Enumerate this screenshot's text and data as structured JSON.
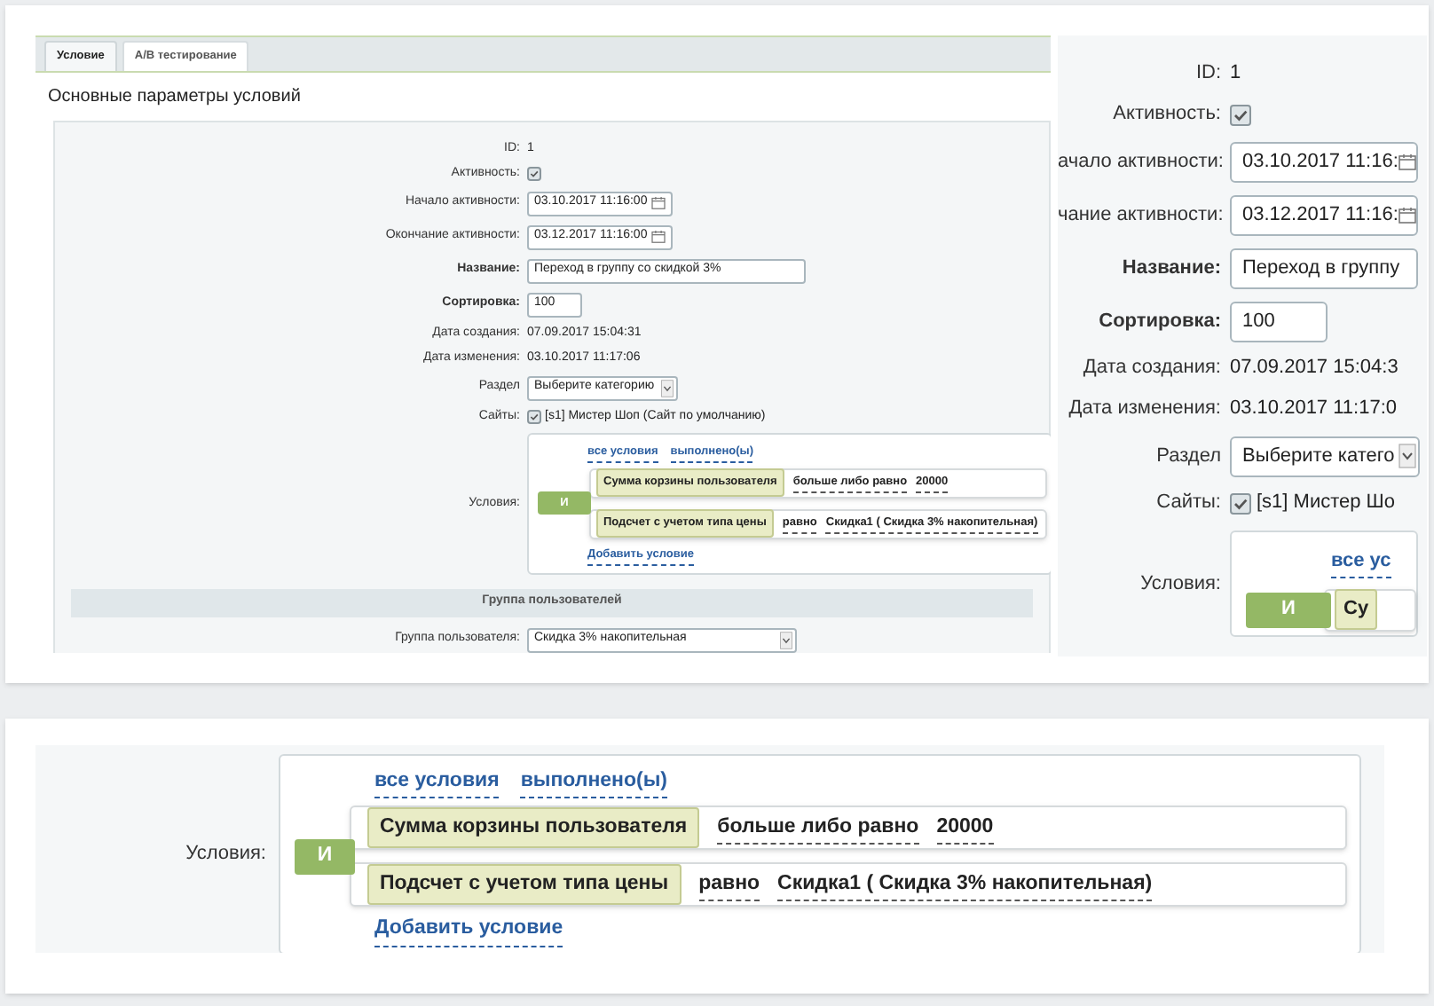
{
  "screenshot": {
    "tabs": [
      {
        "label": "Условие",
        "selected": true
      },
      {
        "label": "A/B тестирование",
        "selected": false
      }
    ],
    "heading": "Основные параметры условий",
    "fields": [
      {
        "kind": "text",
        "label": "ID:",
        "value": "1",
        "required": false
      },
      {
        "kind": "checkbox",
        "label": "Активность:",
        "checked": true,
        "required": false
      },
      {
        "kind": "date",
        "label": "Начало активности:",
        "value": "03.10.2017 11:16:00",
        "required": false
      },
      {
        "kind": "date",
        "label": "Окончание активности:",
        "value": "03.12.2017 11:16:00",
        "required": false
      },
      {
        "kind": "input",
        "label": "Название:",
        "value": "Переход в группу со скидкой 3%",
        "required": true
      },
      {
        "kind": "input",
        "label": "Сортировка:",
        "value": "100",
        "required": true
      },
      {
        "kind": "text",
        "label": "Дата создания:",
        "value": "07.09.2017 15:04:31",
        "required": false
      },
      {
        "kind": "text",
        "label": "Дата изменения:",
        "value": "03.10.2017 11:17:06",
        "required": false
      },
      {
        "kind": "select",
        "label": "Раздел",
        "value": "Выберите категорию",
        "required": false
      },
      {
        "kind": "checkbox",
        "label": "Сайты:",
        "checked": true,
        "value": "[s1] Мистер Шоп (Сайт по умолчанию)",
        "required": false
      },
      {
        "kind": "conditions",
        "label": "Условия:",
        "required": false,
        "logic": "И",
        "links": [
          "все условия",
          "выполнено(ы)"
        ],
        "rules": [
          {
            "name": "Сумма корзины пользователя",
            "operator": "больше либо равно",
            "value": "20000"
          },
          {
            "name": "Подсчет с учетом типа цены",
            "operator": "равно",
            "value": "Скидка1 ( Скидка 3% накопительная)"
          }
        ],
        "add": "Добавить условие"
      }
    ],
    "section": "Группа пользователей",
    "group_field": {
      "label": "Группа пользователя:",
      "value": "Скидка 3% накопительная"
    }
  },
  "zoom_right": {
    "fields": [
      {
        "kind": "text",
        "label": "ID:",
        "value": "1",
        "required": false
      },
      {
        "kind": "checkbox",
        "label": "Активность:",
        "checked": true,
        "required": false
      },
      {
        "kind": "date",
        "label": "ачало активности:",
        "value": "03.10.2017 11:16:",
        "required": false
      },
      {
        "kind": "date",
        "label": "чание активности:",
        "value": "03.12.2017 11:16:",
        "required": false
      },
      {
        "kind": "input",
        "label": "Название:",
        "value": "Переход в группу",
        "required": true
      },
      {
        "kind": "input",
        "label": "Сортировка:",
        "value": "100",
        "required": true
      },
      {
        "kind": "text",
        "label": "Дата создания:",
        "value": "07.09.2017 15:04:3",
        "required": false
      },
      {
        "kind": "text",
        "label": "Дата изменения:",
        "value": "03.10.2017 11:17:0",
        "required": false
      },
      {
        "kind": "select",
        "label": "Раздел",
        "value": "Выберите катего",
        "required": false
      },
      {
        "kind": "checkbox",
        "label": "Сайты:",
        "checked": true,
        "value": "[s1] Мистер Шо",
        "required": false
      },
      {
        "kind": "conditions",
        "label": "Условия:",
        "required": false,
        "logic": "И",
        "links": [
          "все ус"
        ],
        "rules": [
          {
            "name": "Су"
          }
        ]
      }
    ]
  },
  "zoom_bottom": {
    "fields": [
      {
        "kind": "conditions",
        "label": "Условия:",
        "required": false,
        "logic": "И",
        "links": [
          "все условия",
          "выполнено(ы)"
        ],
        "rules": [
          {
            "name": "Сумма корзины пользователя",
            "operator": "больше либо равно",
            "value": "20000"
          },
          {
            "name": "Подсчет с учетом типа цены",
            "operator": "равно",
            "value": "Скидка1 ( Скидка 3% накопительная)"
          }
        ],
        "add": "Добавить условие"
      }
    ]
  }
}
